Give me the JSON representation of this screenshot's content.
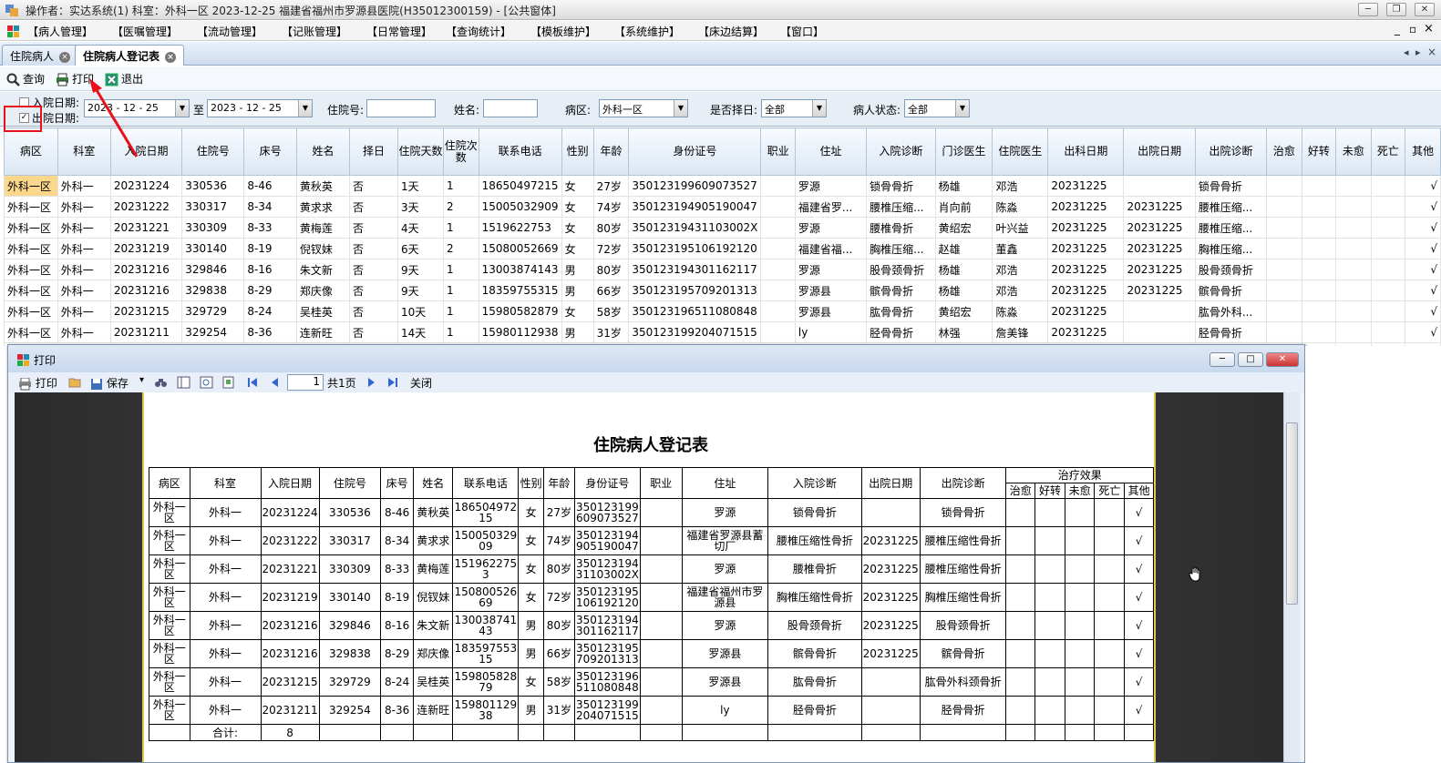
{
  "window": {
    "title": "操作者：实达系统(1)  科室：外科一区  2023-12-25  福建省福州市罗源县医院(H35012300159) - [公共窗体]",
    "btn_min": "─",
    "btn_restore": "❐",
    "btn_close": "✕"
  },
  "menu": [
    "【病人管理】",
    "【医嘱管理】",
    "【流动管理】",
    "【记账管理】",
    "【日常管理】",
    "【查询统计】",
    "【模板维护】",
    "【系统维护】",
    "【床边结算】",
    "【窗口】"
  ],
  "menu_right": {
    "min": "_",
    "restore": "▫",
    "close": "×"
  },
  "tabs": [
    {
      "label": "住院病人",
      "close": "×"
    },
    {
      "label": "住院病人登记表",
      "close": "×"
    }
  ],
  "tab_nav": {
    "left": "◂",
    "right": "▸",
    "close": "×"
  },
  "toolbar": {
    "query": "查询",
    "print": "打印",
    "exit": "退出"
  },
  "filters": {
    "admit_date_label": "入院日期:",
    "discharge_date_label": "出院日期:",
    "admit_checked": "",
    "discharge_checked": "✓",
    "date_from": "2023 - 12 - 25",
    "to_label": "至",
    "date_to": "2023 - 12 - 25",
    "inpatient_no_label": "住院号:",
    "inpatient_no": "",
    "name_label": "姓名:",
    "name": "",
    "ward_label": "病区:",
    "ward": "外科一区",
    "select_day_label": "是否择日:",
    "select_day": "全部",
    "status_label": "病人状态:",
    "status": "全部",
    "dd_arrow": "▼"
  },
  "grid": {
    "headers": [
      "病区",
      "科室",
      "入院日期",
      "住院号",
      "床号",
      "姓名",
      "择日",
      "住院天数",
      "住院次数",
      "联系电话",
      "性别",
      "年龄",
      "身份证号",
      "职业",
      "住址",
      "入院诊断",
      "门诊医生",
      "住院医生",
      "出科日期",
      "出院日期",
      "出院诊断",
      "治愈",
      "好转",
      "未愈",
      "死亡",
      "其他"
    ],
    "rows": [
      [
        "外科一区",
        "外科一",
        "20231224",
        "330536",
        "8-46",
        "黄秋英",
        "否",
        "1天",
        "1",
        "18650497215",
        "女",
        "27岁",
        "350123199609073527",
        "",
        "罗源",
        "锁骨骨折",
        "杨雄",
        "邓浩",
        "20231225",
        "",
        "锁骨骨折",
        "",
        "",
        "",
        "",
        "√"
      ],
      [
        "外科一区",
        "外科一",
        "20231222",
        "330317",
        "8-34",
        "黄求求",
        "否",
        "3天",
        "2",
        "15005032909",
        "女",
        "74岁",
        "350123194905190047",
        "",
        "福建省罗...",
        "腰椎压缩...",
        "肖向前",
        "陈淼",
        "20231225",
        "20231225",
        "腰椎压缩...",
        "",
        "",
        "",
        "",
        "√"
      ],
      [
        "外科一区",
        "外科一",
        "20231221",
        "330309",
        "8-33",
        "黄梅莲",
        "否",
        "4天",
        "1",
        "1519622753",
        "女",
        "80岁",
        "35012319431103002X",
        "",
        "罗源",
        "腰椎骨折",
        "黄绍宏",
        "叶兴益",
        "20231225",
        "20231225",
        "腰椎压缩...",
        "",
        "",
        "",
        "",
        "√"
      ],
      [
        "外科一区",
        "外科一",
        "20231219",
        "330140",
        "8-19",
        "倪钗妹",
        "否",
        "6天",
        "2",
        "15080052669",
        "女",
        "72岁",
        "350123195106192120",
        "",
        "福建省福...",
        "胸椎压缩...",
        "赵雄",
        "董鑫",
        "20231225",
        "20231225",
        "胸椎压缩...",
        "",
        "",
        "",
        "",
        "√"
      ],
      [
        "外科一区",
        "外科一",
        "20231216",
        "329846",
        "8-16",
        "朱文新",
        "否",
        "9天",
        "1",
        "13003874143",
        "男",
        "80岁",
        "350123194301162117",
        "",
        "罗源",
        "股骨颈骨折",
        "杨雄",
        "邓浩",
        "20231225",
        "20231225",
        "股骨颈骨折",
        "",
        "",
        "",
        "",
        "√"
      ],
      [
        "外科一区",
        "外科一",
        "20231216",
        "329838",
        "8-29",
        "郑庆像",
        "否",
        "9天",
        "1",
        "18359755315",
        "男",
        "66岁",
        "350123195709201313",
        "",
        "罗源县",
        "髌骨骨折",
        "杨雄",
        "邓浩",
        "20231225",
        "20231225",
        "髌骨骨折",
        "",
        "",
        "",
        "",
        "√"
      ],
      [
        "外科一区",
        "外科一",
        "20231215",
        "329729",
        "8-24",
        "吴桂英",
        "否",
        "10天",
        "1",
        "15980582879",
        "女",
        "58岁",
        "350123196511080848",
        "",
        "罗源县",
        "肱骨骨折",
        "黄绍宏",
        "陈淼",
        "20231225",
        "",
        "肱骨外科...",
        "",
        "",
        "",
        "",
        "√"
      ],
      [
        "外科一区",
        "外科一",
        "20231211",
        "329254",
        "8-36",
        "连新旺",
        "否",
        "14天",
        "1",
        "15980112938",
        "男",
        "31岁",
        "350123199204071515",
        "",
        "ly",
        "胫骨骨折",
        "林强",
        "詹美锋",
        "20231225",
        "",
        "胫骨骨折",
        "",
        "",
        "",
        "",
        "√"
      ]
    ]
  },
  "dialog": {
    "title": "打印",
    "btn_min": "─",
    "btn_max": "□",
    "btn_close": "✕",
    "toolbar": {
      "print": "打印",
      "save": "保存",
      "save_arrow": "▾",
      "page": "1",
      "page_total": "共1页",
      "close": "关闭"
    }
  },
  "report": {
    "title": "住院病人登记表",
    "headers": [
      "病区",
      "科室",
      "入院日期",
      "住院号",
      "床号",
      "姓名",
      "联系电话",
      "性别",
      "年龄",
      "身份证号",
      "职业",
      "住址",
      "入院诊断",
      "出院日期",
      "出院诊断"
    ],
    "effect_header": "治疗效果",
    "effect_cols": [
      "治愈",
      "好转",
      "未愈",
      "死亡",
      "其他"
    ],
    "rows": [
      [
        "外科一\n区",
        "外科一",
        "20231224",
        "330536",
        "8-46",
        "黄秋英",
        "186504972\n15",
        "女",
        "27岁",
        "350123199\n609073527",
        "",
        "罗源",
        "锁骨骨折",
        "",
        "锁骨骨折",
        "",
        "",
        "",
        "",
        "√"
      ],
      [
        "外科一\n区",
        "外科一",
        "20231222",
        "330317",
        "8-34",
        "黄求求",
        "150050329\n09",
        "女",
        "74岁",
        "350123194\n905190047",
        "",
        "福建省罗源县蓄\n切厂",
        "腰椎压缩性骨折",
        "20231225",
        "腰椎压缩性骨折",
        "",
        "",
        "",
        "",
        "√"
      ],
      [
        "外科一\n区",
        "外科一",
        "20231221",
        "330309",
        "8-33",
        "黄梅莲",
        "151962275\n3",
        "女",
        "80岁",
        "350123194\n31103002X",
        "",
        "罗源",
        "腰椎骨折",
        "20231225",
        "腰椎压缩性骨折",
        "",
        "",
        "",
        "",
        "√"
      ],
      [
        "外科一\n区",
        "外科一",
        "20231219",
        "330140",
        "8-19",
        "倪钗妹",
        "150800526\n69",
        "女",
        "72岁",
        "350123195\n106192120",
        "",
        "福建省福州市罗\n源县",
        "胸椎压缩性骨折",
        "20231225",
        "胸椎压缩性骨折",
        "",
        "",
        "",
        "",
        "√"
      ],
      [
        "外科一\n区",
        "外科一",
        "20231216",
        "329846",
        "8-16",
        "朱文新",
        "130038741\n43",
        "男",
        "80岁",
        "350123194\n301162117",
        "",
        "罗源",
        "股骨颈骨折",
        "20231225",
        "股骨颈骨折",
        "",
        "",
        "",
        "",
        "√"
      ],
      [
        "外科一\n区",
        "外科一",
        "20231216",
        "329838",
        "8-29",
        "郑庆像",
        "183597553\n15",
        "男",
        "66岁",
        "350123195\n709201313",
        "",
        "罗源县",
        "髌骨骨折",
        "20231225",
        "髌骨骨折",
        "",
        "",
        "",
        "",
        "√"
      ],
      [
        "外科一\n区",
        "外科一",
        "20231215",
        "329729",
        "8-24",
        "吴桂英",
        "159805828\n79",
        "女",
        "58岁",
        "350123196\n511080848",
        "",
        "罗源县",
        "肱骨骨折",
        "",
        "肱骨外科颈骨折",
        "",
        "",
        "",
        "",
        "√"
      ],
      [
        "外科一\n区",
        "外科一",
        "20231211",
        "329254",
        "8-36",
        "连新旺",
        "159801129\n38",
        "男",
        "31岁",
        "350123199\n204071515",
        "",
        "ly",
        "胫骨骨折",
        "",
        "胫骨骨折",
        "",
        "",
        "",
        "",
        "√"
      ]
    ],
    "total_label": "合计:",
    "total_value": "8"
  },
  "colors": {
    "accent_red": "#e8101b",
    "selected_cell": "#fbd78c",
    "tab_active": "#ffffff"
  }
}
